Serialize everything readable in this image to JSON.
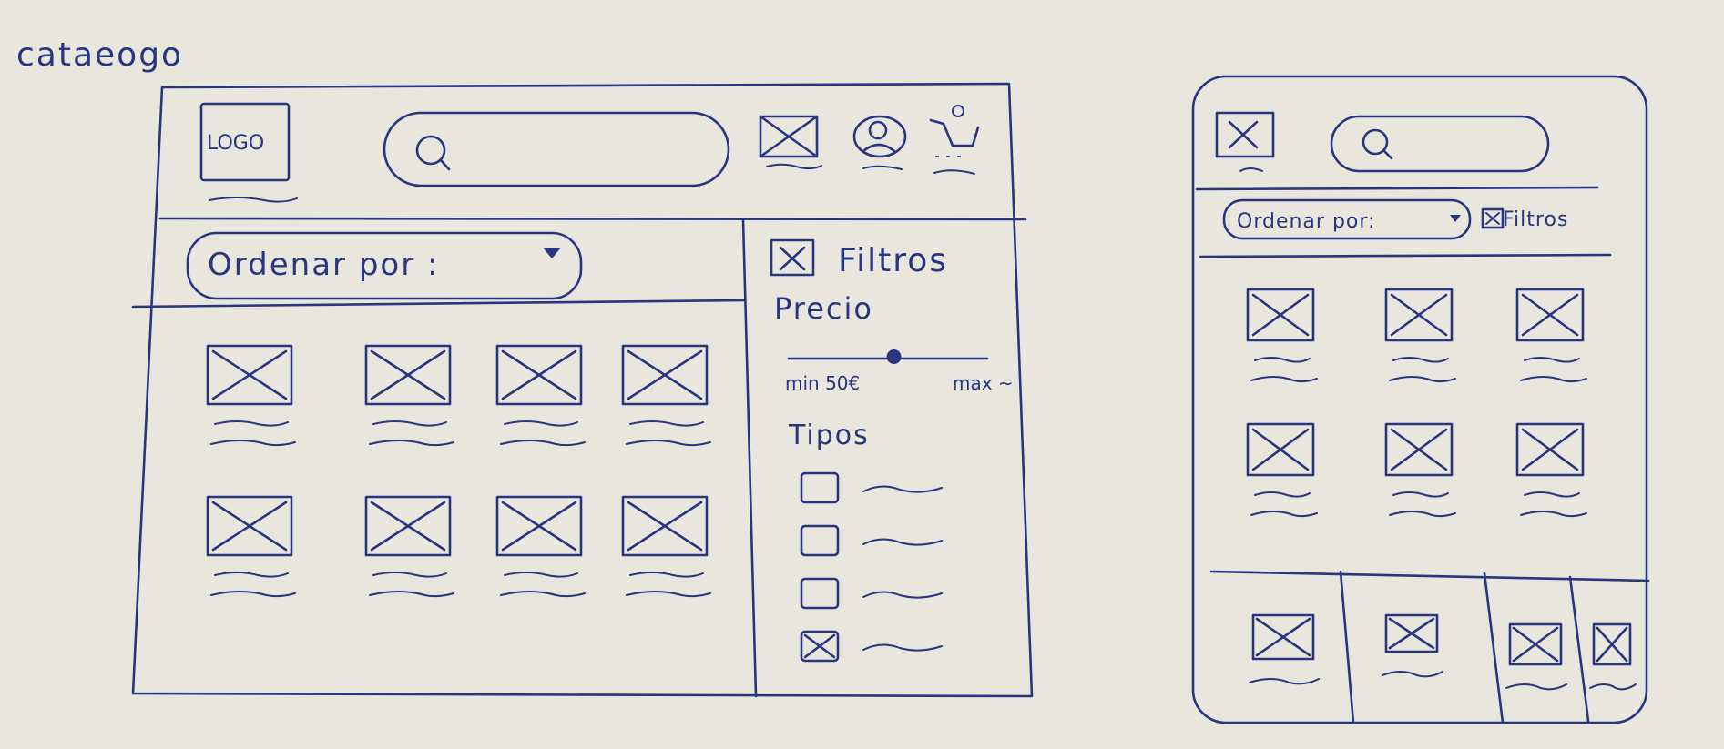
{
  "page_title": "cataeogo",
  "desktop": {
    "logo_label": "LOGO",
    "sort_label": "Ordenar por :",
    "filters_label": "Filtros",
    "price_label": "Precio",
    "price_min_label": "min 50€",
    "price_max_label": "max ~",
    "types_label": "Tipos",
    "type_options": [
      {
        "checked": false
      },
      {
        "checked": false
      },
      {
        "checked": false
      },
      {
        "checked": true
      }
    ],
    "price_value_fraction": 0.53
  },
  "mobile": {
    "sort_label": "Ordenar por:",
    "filters_label": "Filtros"
  }
}
